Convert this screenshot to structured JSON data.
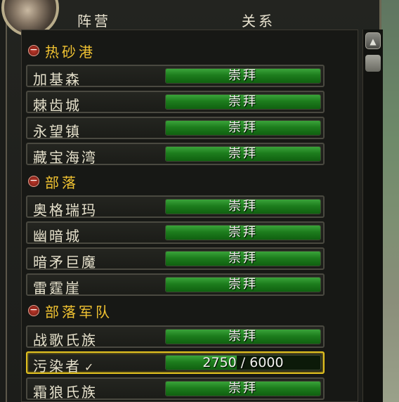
{
  "columns": {
    "faction": "阵营",
    "standing": "关系"
  },
  "groups": [
    {
      "label": "热砂港",
      "rows": [
        {
          "name": "加基森",
          "standing": "崇拜",
          "progress": 1
        },
        {
          "name": "棘齿城",
          "standing": "崇拜",
          "progress": 1
        },
        {
          "name": "永望镇",
          "standing": "崇拜",
          "progress": 1
        },
        {
          "name": "藏宝海湾",
          "standing": "崇拜",
          "progress": 1
        }
      ]
    },
    {
      "label": "部落",
      "rows": [
        {
          "name": "奥格瑞玛",
          "standing": "崇拜",
          "progress": 1
        },
        {
          "name": "幽暗城",
          "standing": "崇拜",
          "progress": 1
        },
        {
          "name": "暗矛巨魔",
          "standing": "崇拜",
          "progress": 1
        },
        {
          "name": "雷霆崖",
          "standing": "崇拜",
          "progress": 1
        }
      ]
    },
    {
      "label": "部落军队",
      "rows": [
        {
          "name": "战歌氏族",
          "standing": "崇拜",
          "progress": 1
        },
        {
          "name": "污染者",
          "standing": "2750 / 6000",
          "progress": 0.458,
          "checked": true,
          "check_glyph": "✓"
        },
        {
          "name": "霜狼氏族",
          "standing": "崇拜",
          "progress": 1
        }
      ]
    }
  ],
  "colors": {
    "bar_fill": "#1d7d1d",
    "group_label": "#f0c232",
    "selected_border": "#e0c020"
  }
}
